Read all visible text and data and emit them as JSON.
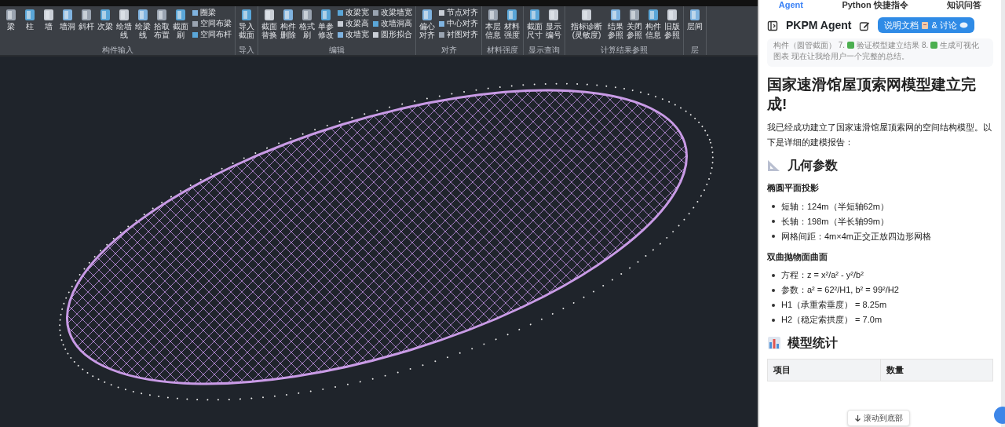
{
  "ribbon": {
    "groups": [
      {
        "label": "构件输入",
        "buttons": [
          {
            "label": "梁",
            "kind": "large"
          },
          {
            "label": "柱",
            "kind": "large"
          },
          {
            "label": "墙",
            "kind": "large"
          },
          {
            "label": "墙洞",
            "kind": "large"
          },
          {
            "label": "斜杆",
            "kind": "large"
          },
          {
            "label": "次梁",
            "kind": "large"
          },
          {
            "label": "绘墙线",
            "kind": "large"
          },
          {
            "label": "绘梁线",
            "kind": "large"
          },
          {
            "label": "拾取布置",
            "kind": "large"
          },
          {
            "label": "截面刷",
            "kind": "large"
          },
          {
            "label": "圈梁",
            "kind": "small"
          },
          {
            "label": "空间布梁",
            "kind": "small"
          },
          {
            "label": "空间布杆",
            "kind": "small"
          }
        ]
      },
      {
        "label": "导入",
        "buttons": [
          {
            "label": "导入截面",
            "kind": "large"
          }
        ]
      },
      {
        "label": "编辑",
        "buttons": [
          {
            "label": "截面替换",
            "kind": "large"
          },
          {
            "label": "构件删除",
            "kind": "large"
          },
          {
            "label": "格式刷",
            "kind": "large"
          },
          {
            "label": "单参修改",
            "kind": "large"
          },
          {
            "label": "改梁宽",
            "kind": "small"
          },
          {
            "label": "改梁高",
            "kind": "small"
          },
          {
            "label": "改墙宽",
            "kind": "small"
          },
          {
            "label": "改梁墙宽",
            "kind": "small"
          },
          {
            "label": "改墙洞高",
            "kind": "small"
          },
          {
            "label": "圆形拟合",
            "kind": "small"
          }
        ]
      },
      {
        "label": "对齐",
        "buttons": [
          {
            "label": "偏心对齐",
            "kind": "large"
          },
          {
            "label": "节点对齐",
            "kind": "small"
          },
          {
            "label": "中心对齐",
            "kind": "small"
          },
          {
            "label": "衬图对齐",
            "kind": "small"
          }
        ]
      },
      {
        "label": "材料强度",
        "buttons": [
          {
            "label": "本层信息",
            "kind": "large"
          },
          {
            "label": "材料强度",
            "kind": "large"
          }
        ]
      },
      {
        "label": "显示查询",
        "buttons": [
          {
            "label": "截面尺寸",
            "kind": "large"
          },
          {
            "label": "显示编号",
            "kind": "large"
          }
        ]
      },
      {
        "label": "计算结果参照",
        "buttons": [
          {
            "label": "指标诊断(灵敏度)",
            "kind": "wide"
          },
          {
            "label": "结果参照",
            "kind": "large"
          },
          {
            "label": "关闭参照",
            "kind": "large"
          },
          {
            "label": "构件信息",
            "kind": "large"
          },
          {
            "label": "旧版参照",
            "kind": "large"
          }
        ]
      },
      {
        "label": "层",
        "buttons": [
          {
            "label": "层间",
            "kind": "large"
          }
        ]
      }
    ]
  },
  "panel": {
    "tabs": [
      {
        "label": "Agent",
        "selected": true
      },
      {
        "label": "Python 快捷指令",
        "selected": false
      },
      {
        "label": "知识问答",
        "selected": false
      }
    ],
    "title": "PKPM Agent",
    "docs_button": {
      "label": "说明文档",
      "label_2": "& 讨论"
    },
    "thinking": [
      "构件（圆管截面） 7.",
      "验证模型建立结果 8.",
      "生成可视化图表 现在让我给用户一个完整的总结。"
    ],
    "heading": "国家速滑馆屋顶索网模型建立完成!",
    "intro": "我已经成功建立了国家速滑馆屋顶索网的空间结构模型。以下是详细的建模报告：",
    "sections": [
      {
        "title": "几何参数",
        "blocks": [
          {
            "label": "椭圆平面投影",
            "items": [
              "短轴：124m（半短轴62m）",
              "长轴：198m（半长轴99m）",
              "网格间距：4m×4m正交正放四边形网格"
            ]
          },
          {
            "label": "双曲抛物面曲面",
            "items": [
              "方程：z = x²/a² - y²/b²",
              "参数：a² = 62²/H1, b² = 99²/H2",
              "H1（承重索垂度） = 8.25m",
              "H2（稳定索拱度） = 7.0m"
            ]
          }
        ]
      },
      {
        "title": "模型统计",
        "table": {
          "columns": [
            "项目",
            "数量"
          ]
        }
      }
    ],
    "scroll_button": "滚动到底部"
  }
}
